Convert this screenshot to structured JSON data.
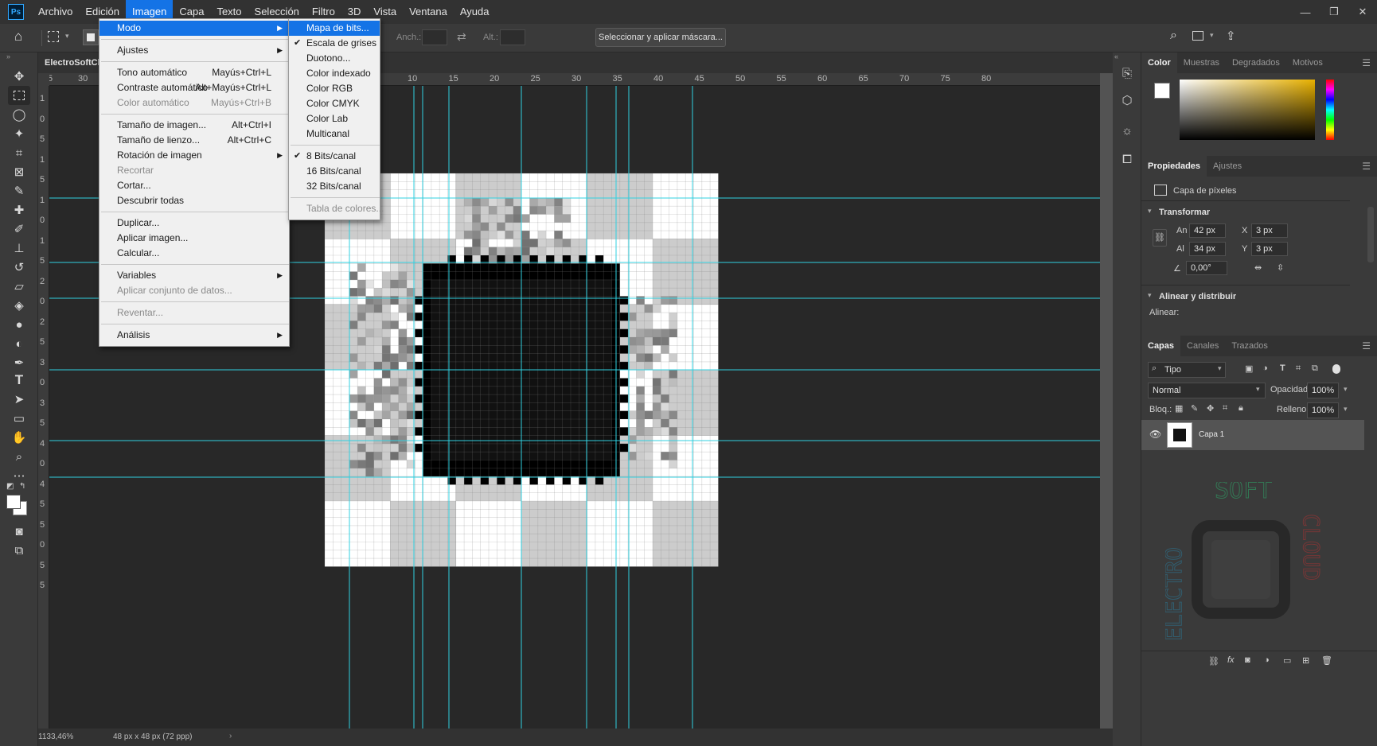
{
  "app": {
    "logo": "Ps"
  },
  "menubar": {
    "items": [
      "Archivo",
      "Edición",
      "Imagen",
      "Capa",
      "Texto",
      "Selección",
      "Filtro",
      "3D",
      "Vista",
      "Ventana",
      "Ayuda"
    ],
    "open_index": 2
  },
  "window_controls": {
    "minimize": "—",
    "restore": "❐",
    "close": "✕"
  },
  "options_bar": {
    "width_label": "Anch.:",
    "height_label": "Alt.:",
    "mask_button": "Seleccionar y aplicar máscara..."
  },
  "document": {
    "tab_title": "ElectroSoftClou",
    "zoom": "1133,46%",
    "doc_info": "48 px x 48 px (72 ppp)",
    "ruler_top": [
      "5",
      "30",
      "10",
      "15",
      "20",
      "25",
      "30",
      "35",
      "40",
      "45",
      "50",
      "55",
      "60",
      "65",
      "70",
      "75",
      "80"
    ],
    "ruler_left": [
      "1",
      "0",
      "5",
      "1",
      "5",
      "1",
      "0",
      "1",
      "5",
      "2",
      "0",
      "2",
      "5",
      "3",
      "0",
      "3",
      "5",
      "4",
      "0",
      "4",
      "5",
      "5",
      "0",
      "5",
      "5"
    ]
  },
  "image_menu": {
    "items": [
      {
        "label": "Modo",
        "submenu": true,
        "highlight": true
      },
      {
        "sep": true
      },
      {
        "label": "Ajustes",
        "submenu": true
      },
      {
        "sep": true
      },
      {
        "label": "Tono automático",
        "shortcut": "Mayús+Ctrl+L"
      },
      {
        "label": "Contraste automático",
        "shortcut": "Alt+Mayús+Ctrl+L"
      },
      {
        "label": "Color automático",
        "shortcut": "Mayús+Ctrl+B",
        "disabled": true
      },
      {
        "sep": true
      },
      {
        "label": "Tamaño de imagen...",
        "shortcut": "Alt+Ctrl+I"
      },
      {
        "label": "Tamaño de lienzo...",
        "shortcut": "Alt+Ctrl+C"
      },
      {
        "label": "Rotación de imagen",
        "submenu": true
      },
      {
        "label": "Recortar",
        "disabled": true
      },
      {
        "label": "Cortar..."
      },
      {
        "label": "Descubrir todas"
      },
      {
        "sep": true
      },
      {
        "label": "Duplicar..."
      },
      {
        "label": "Aplicar imagen..."
      },
      {
        "label": "Calcular..."
      },
      {
        "sep": true
      },
      {
        "label": "Variables",
        "submenu": true
      },
      {
        "label": "Aplicar conjunto de datos...",
        "disabled": true
      },
      {
        "sep": true
      },
      {
        "label": "Reventar...",
        "disabled": true
      },
      {
        "sep": true
      },
      {
        "label": "Análisis",
        "submenu": true
      }
    ]
  },
  "mode_menu": {
    "items": [
      {
        "label": "Mapa de bits...",
        "highlight": true
      },
      {
        "label": "Escala de grises",
        "checked": true
      },
      {
        "label": "Duotono..."
      },
      {
        "label": "Color indexado"
      },
      {
        "label": "Color RGB"
      },
      {
        "label": "Color CMYK"
      },
      {
        "label": "Color Lab"
      },
      {
        "label": "Multicanal"
      },
      {
        "sep": true
      },
      {
        "label": "8 Bits/canal",
        "checked": true
      },
      {
        "label": "16 Bits/canal"
      },
      {
        "label": "32 Bits/canal"
      },
      {
        "sep": true
      },
      {
        "label": "Tabla de colores...",
        "disabled": true
      }
    ]
  },
  "color_panel": {
    "tabs": [
      "Color",
      "Muestras",
      "Degradados",
      "Motivos"
    ]
  },
  "properties_panel": {
    "tabs": [
      "Propiedades",
      "Ajustes"
    ],
    "layer_type": "Capa de píxeles",
    "transform_title": "Transformar",
    "an_label": "An",
    "an_value": "42 px",
    "al_label": "Al",
    "al_value": "34 px",
    "x_label": "X",
    "x_value": "3 px",
    "y_label": "Y",
    "y_value": "3 px",
    "angle_value": "0,00°",
    "align_title": "Alinear y distribuir",
    "align_label": "Alinear:"
  },
  "layers_panel": {
    "tabs": [
      "Capas",
      "Canales",
      "Trazados"
    ],
    "filter": "Tipo",
    "blend_mode": "Normal",
    "opacity_label": "Opacidad:",
    "opacity_value": "100%",
    "lock_label": "Bloq.:",
    "fill_label": "Relleno:",
    "fill_value": "100%",
    "layer_name": "Capa 1"
  },
  "accent": "#1473e6",
  "guide_color": "#30d0e0"
}
